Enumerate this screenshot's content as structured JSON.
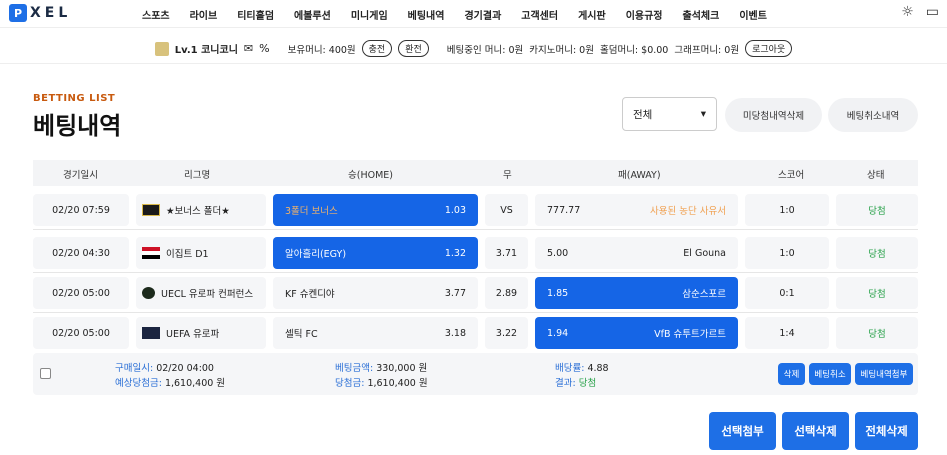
{
  "logo": {
    "mark": "P",
    "text": "XEL"
  },
  "nav": [
    "스포츠",
    "라이브",
    "티티홀덤",
    "에볼루션",
    "미니게임",
    "베팅내역",
    "경기결과",
    "고객센터",
    "게시판",
    "이용규정",
    "출석체크",
    "이벤트"
  ],
  "user": {
    "level": "Lv.1 코니코니",
    "mail_icon": "✉",
    "percent_icon": "%",
    "balance": "보유머니: 400원",
    "deposit": "충전",
    "withdraw": "환전",
    "betting_money": "베팅중인 머니: 0원",
    "casino_money": "카지노머니: 0원",
    "holdem_money": "홀덤머니: $0.00",
    "graph_money": "그래프머니: 0원",
    "logout": "로그아웃"
  },
  "page": {
    "subtitle": "BETTING LIST",
    "title": "베팅내역"
  },
  "filter": {
    "selected": "전체",
    "arrow": "▾"
  },
  "actions": {
    "delete_unsettled": "미당첨내역삭제",
    "cancel_history": "베팅취소내역"
  },
  "columns": [
    "경기일시",
    "리그명",
    "승(HOME)",
    "무",
    "패(AWAY)",
    "스코어",
    "상태"
  ],
  "rows": [
    {
      "date": "02/20 07:59",
      "league": "★보너스 폴더★",
      "home": "3폴더 보너스",
      "home_odds": "1.03",
      "draw": "VS",
      "away": "777.77",
      "away_name": "사용된 농단 사유서",
      "away_odds": "",
      "score": "1:0",
      "status": "당첨"
    },
    {
      "date": "02/20 04:30",
      "league": "이집트 D1",
      "home": "알아흘리(EGY)",
      "home_odds": "1.32",
      "draw": "3.71",
      "away": "5.00",
      "away_name": "El Gouna",
      "away_odds": "",
      "score": "1:0",
      "status": "당첨"
    },
    {
      "date": "02/20 05:00",
      "league": "UECL 유로파 컨퍼런스",
      "home": "KF 슈켄디야",
      "home_odds": "3.77",
      "draw": "2.89",
      "away": "1.85",
      "away_name": "삼순스포르",
      "away_odds": "",
      "score": "0:1",
      "status": "당첨"
    },
    {
      "date": "02/20 05:00",
      "league": "UEFA 유로파",
      "home": "셀틱 FC",
      "home_odds": "3.18",
      "draw": "3.22",
      "away": "1.94",
      "away_name": "VfB 슈투트가르트",
      "away_odds": "",
      "score": "1:4",
      "status": "당첨"
    }
  ],
  "summary": {
    "purchase_label": "구매일시:",
    "purchase_value": "02/20 04:00",
    "expected_label": "예상당첨금:",
    "expected_value": "1,610,400 원",
    "bet_label": "베팅금액:",
    "bet_value": "330,000 원",
    "win_label": "당첨금:",
    "win_value": "1,610,400 원",
    "odds_label": "배당률:",
    "odds_value": "4.88",
    "result_label": "결과:",
    "result_value": "당첨",
    "btn_delete": "삭제",
    "btn_cancel": "베팅취소",
    "btn_attach": "베팅내역첨부"
  },
  "bottom": {
    "attach_selected": "선택첨부",
    "delete_selected": "선택삭제",
    "delete_all": "전체삭제"
  }
}
